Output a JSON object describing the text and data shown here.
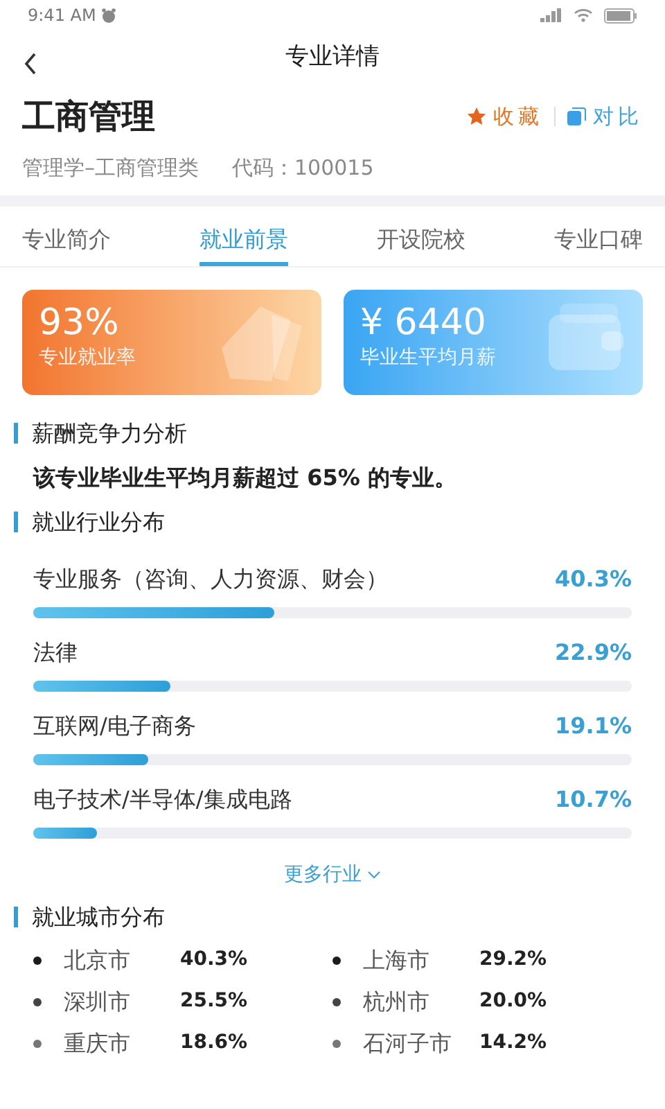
{
  "status_bar": {
    "time": "9:41 AM"
  },
  "nav": {
    "title": "专业详情"
  },
  "major": {
    "name": "工商管理",
    "category": "管理学–工商管理类",
    "code": "代码：100015"
  },
  "actions": [
    {
      "kind": "favorite",
      "label": "收藏"
    },
    {
      "kind": "compare",
      "label": "对比"
    }
  ],
  "tabs": [
    {
      "label": "专业简介",
      "selected": false
    },
    {
      "label": "就业前景",
      "selected": true
    },
    {
      "label": "开设院校",
      "selected": false
    },
    {
      "label": "专业口碑",
      "selected": false
    }
  ],
  "stats": [
    {
      "kind": "rate",
      "value": "93%",
      "label": "专业就业率"
    },
    {
      "kind": "salary",
      "value": "¥ 6440",
      "label": "毕业生平均月薪"
    }
  ],
  "salary_section": {
    "heading": "薪酬竞争力分析",
    "sentence": "该专业毕业生平均月薪超过 **65%** 的专业。"
  },
  "industry_section": {
    "heading": "就业行业分布",
    "more": "更多行业"
  },
  "industries": [
    {
      "name": "专业服务（咨询、人力资源、财会）",
      "reading": "40.3%",
      "level": 0.403
    },
    {
      "name": "法律",
      "reading": "22.9%",
      "level": 0.229
    },
    {
      "name": "互联网/电子商务",
      "reading": "19.1%",
      "level": 0.191
    },
    {
      "name": "电子技术/半导体/集成电路",
      "reading": "10.7%",
      "level": 0.107
    }
  ],
  "city_section": {
    "heading": "就业城市分布"
  },
  "cities": [
    {
      "name": "北京市",
      "reading": "40.3%",
      "color": "#1c1c1c"
    },
    {
      "name": "上海市",
      "reading": "29.2%",
      "color": "#1c1c1c"
    },
    {
      "name": "深圳市",
      "reading": "25.5%",
      "color": "#444444"
    },
    {
      "name": "杭州市",
      "reading": "20.0%",
      "color": "#444444"
    },
    {
      "name": "重庆市",
      "reading": "18.6%",
      "color": "#777777"
    },
    {
      "name": "石河子市",
      "reading": "14.2%",
      "color": "#777777"
    }
  ]
}
